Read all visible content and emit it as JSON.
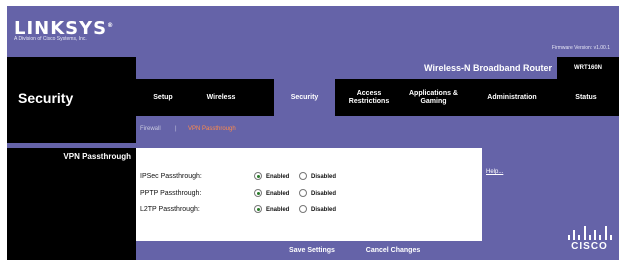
{
  "brand": {
    "logo": "LINKSYS",
    "logo_mark": "®",
    "subtitle": "A Division of Cisco Systems, Inc.",
    "firmware": "Firmware Version: v1.00.1"
  },
  "product": {
    "name": "Wireless-N Broadband Router",
    "model": "WRT160N"
  },
  "section_title": "Security",
  "nav": {
    "tabs": [
      {
        "label": "Setup"
      },
      {
        "label": "Wireless"
      },
      {
        "label": "Security"
      },
      {
        "label": "Access Restrictions"
      },
      {
        "label": "Applications & Gaming"
      },
      {
        "label": "Administration"
      },
      {
        "label": "Status"
      }
    ],
    "active": "Security"
  },
  "subnav": {
    "items": [
      {
        "label": "Firewall"
      },
      {
        "label": "VPN Passthrough"
      }
    ],
    "separator": "|",
    "current": "VPN Passthrough"
  },
  "left": {
    "section_label": "VPN Passthrough"
  },
  "form": {
    "rows": [
      {
        "label": "IPSec Passthrough:",
        "options": [
          "Enabled",
          "Disabled"
        ],
        "selected": "Enabled"
      },
      {
        "label": "PPTP Passthrough:",
        "options": [
          "Enabled",
          "Disabled"
        ],
        "selected": "Enabled"
      },
      {
        "label": "L2TP Passthrough:",
        "options": [
          "Enabled",
          "Disabled"
        ],
        "selected": "Enabled"
      }
    ]
  },
  "help": {
    "link": "Help..."
  },
  "footer": {
    "save_label": "Save Settings",
    "cancel_label": "Cancel Changes"
  },
  "cisco": {
    "text": "CISCO"
  },
  "colors": {
    "brand_purple": "#6563a8",
    "black": "#000000",
    "active_subtab": "#ff8a4a"
  }
}
